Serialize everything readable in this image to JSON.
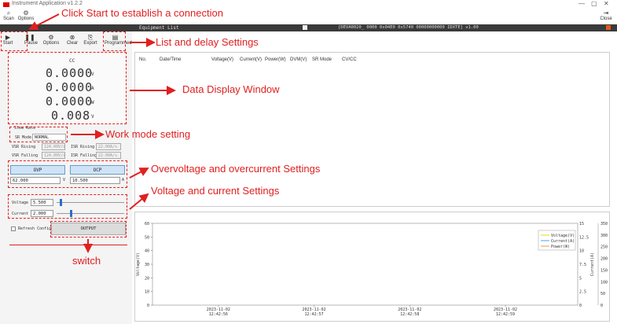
{
  "window": {
    "title": "Instrument Application v1.2.2",
    "minimize": "—",
    "maximize": "▢",
    "close": "✕"
  },
  "toolbar": {
    "scan_label": "Scan",
    "options_label": "Options",
    "close_label": "Close"
  },
  "equipment_bar": {
    "title": "Equipment List",
    "status": "[DEVA0020_ 0000 0x04E0 0x5740 00000000000 IDXTE] v1.00"
  },
  "control_bar": {
    "start": "Start",
    "pause": "Pause",
    "options": "Options",
    "clear": "Clear",
    "export": "Export",
    "programmed": "Programmed"
  },
  "display": {
    "mode": "CC",
    "voltage": "0.0000",
    "voltage_unit": "V",
    "current": "0.0000",
    "current_unit": "A",
    "power": "0.0000",
    "power_unit": "W",
    "dvm": "0.008",
    "dvm_unit": "V"
  },
  "work_mode": {
    "group_label": "Slew Rate",
    "sr_mode_label": "SR Mode",
    "sr_mode_value": "NORMAL",
    "vsr_rising_label": "VSR Rising",
    "vsr_rising_value": "124.00V/s",
    "isr_rising_label": "ISR Rising",
    "isr_rising_value": "22.00A/s",
    "vsr_falling_label": "VSR Falling",
    "vsr_falling_value": "124.00V/s",
    "isr_falling_label": "ISR Falling",
    "isr_falling_value": "22.00A/s"
  },
  "protection": {
    "ovp_label": "OVP",
    "ocp_label": "OCP",
    "ovp_value": "62.000",
    "ovp_unit": "V",
    "ocp_value": "10.500",
    "ocp_unit": "A"
  },
  "setpoints": {
    "voltage_label": "Voltage",
    "voltage_value": "5.500",
    "voltage_level": 0.05,
    "current_label": "Current",
    "current_value": "2.000",
    "current_level": 0.2
  },
  "output": {
    "refresh_label": "Refresh Config",
    "output_label": "OUTPUT"
  },
  "table": {
    "columns": [
      "No.",
      "Date/Time",
      "Voltage(V)",
      "Current(V)",
      "Power(W)",
      "DVM(V)",
      "SR Mode",
      "CV/CC"
    ]
  },
  "annotations": {
    "start_note": "Click Start to establish a connection",
    "list_note": "List and delay Settings",
    "display_note": "Data Display Window",
    "work_mode_note": "Work mode setting",
    "ovp_note": "Overvoltage and overcurrent Settings",
    "setpoint_note": "Voltage and current Settings",
    "switch_note": "switch"
  },
  "colors": {
    "annotation": "#e02020",
    "voltage_series": "#f2d400",
    "current_series": "#4aa3e8",
    "power_series": "#e89a3c"
  },
  "chart_data": {
    "type": "line",
    "x": [
      "2023-11-02 12:42:56",
      "2023-11-02 12:42:57",
      "2023-11-02 12:42:58",
      "2023-11-02 12:42:59"
    ],
    "series": [
      {
        "name": "Voltage(V)",
        "values": []
      },
      {
        "name": "Current(A)",
        "values": []
      },
      {
        "name": "Power(W)",
        "values": []
      }
    ],
    "ylabel_left": "Voltage(V)",
    "ylabel_mid": "Current(A)",
    "ylabel_right": "Power(W)",
    "ylim_left": [
      0,
      60
    ],
    "yticks_left": [
      "0",
      "10",
      "20",
      "30",
      "40",
      "50",
      "60"
    ],
    "ylim_mid": [
      0,
      15
    ],
    "yticks_mid": [
      "0",
      "2.5",
      "5",
      "7.5",
      "10",
      "12.5",
      "15"
    ],
    "ylim_right": [
      0,
      350
    ],
    "yticks_right": [
      "0",
      "50",
      "100",
      "150",
      "200",
      "250",
      "300",
      "350"
    ],
    "xtick_dates": [
      "2023-11-02",
      "2023-11-02",
      "2023-11-02",
      "2023-11-02"
    ],
    "xtick_times": [
      "12:42:56",
      "12:42:57",
      "12:42:58",
      "12:42:59"
    ],
    "legend": "top-right",
    "grid": false
  }
}
